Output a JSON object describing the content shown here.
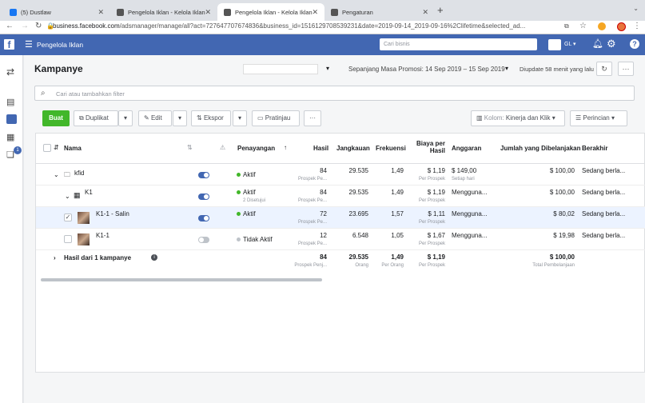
{
  "browser": {
    "tabs": [
      {
        "label": "(5) Dustlaw",
        "active": false
      },
      {
        "label": "Pengelola Iklan - Kelola Iklan",
        "active": false
      },
      {
        "label": "Pengelola Iklan - Kelola Iklan",
        "active": true
      },
      {
        "label": "Pengaturan",
        "active": false
      }
    ],
    "url_host": "business.facebook.com",
    "url_path": "/adsmanager/manage/all?act=727647707674836&business_id=1516129708539231&date=2019-09-14_2019-09-16%2Clifetime&selected_ad..."
  },
  "fbbar": {
    "title": "Pengelola Iklan",
    "business_search_placeholder": "Cari bisnis",
    "account_initials": "GL"
  },
  "leftnav": {
    "badge": "1"
  },
  "page": {
    "title": "Kampanye",
    "daterange": "Sepanjang Masa Promosi: 14 Sep 2019 – 15 Sep 2019",
    "updated": "Diupdate 58 menit yang lalu",
    "filter_placeholder": "Cari atau tambahkan filter"
  },
  "toolbar": {
    "create": "Buat",
    "duplicate": "Duplikat",
    "edit": "Edit",
    "export": "Ekspor",
    "preview": "Pratinjau",
    "more": "···",
    "columns_prefix": "Kolom:",
    "columns_value": "Kinerja dan Klik",
    "breakdown": "Perincian"
  },
  "table": {
    "headers": {
      "name": "Nama",
      "delivery": "Penayangan",
      "results": "Hasil",
      "reach": "Jangkauan",
      "frequency": "Frekuensi",
      "cpr": "Biaya per Hasil",
      "budget": "Anggaran",
      "spent": "Jumlah yang Dibelanjakan",
      "ends": "Berakhir"
    },
    "rows": [
      {
        "name": "kfid",
        "level": "campaign",
        "toggle": true,
        "status": "Aktif",
        "status_sub": "",
        "results": "84",
        "results_sub": "Prospek Pe...",
        "reach": "29.535",
        "freq": "1,49",
        "cpr": "$ 1,19",
        "cpr_sub": "Per Prospek",
        "budget": "$ 149,00",
        "budget_sub": "Setiap hari",
        "spent": "$ 100,00",
        "ends": "Sedang berla..."
      },
      {
        "name": "K1",
        "level": "adset",
        "toggle": true,
        "status": "Aktif",
        "status_sub": "2 Disetujui",
        "results": "84",
        "results_sub": "Prospek Pe...",
        "reach": "29.535",
        "freq": "1,49",
        "cpr": "$ 1,19",
        "cpr_sub": "Per Prospek",
        "budget": "Mengguna...",
        "budget_sub": "",
        "spent": "$ 100,00",
        "ends": "Sedang berla..."
      },
      {
        "name": "K1-1 - Salin",
        "level": "ad",
        "toggle": true,
        "status": "Aktif",
        "status_sub": "",
        "results": "72",
        "results_sub": "Prospek Pe...",
        "reach": "23.695",
        "freq": "1,57",
        "cpr": "$ 1,11",
        "cpr_sub": "Per Prospek",
        "budget": "Mengguna...",
        "budget_sub": "",
        "spent": "$ 80,02",
        "ends": "Sedang berla..."
      },
      {
        "name": "K1-1",
        "level": "ad",
        "toggle": false,
        "status": "Tidak Aktif",
        "status_sub": "",
        "results": "12",
        "results_sub": "Prospek Pe...",
        "reach": "6.548",
        "freq": "1,05",
        "cpr": "$ 1,67",
        "cpr_sub": "Per Prospek",
        "budget": "Mengguna...",
        "budget_sub": "",
        "spent": "$ 19,98",
        "ends": "Sedang berla..."
      }
    ],
    "totals": {
      "label": "Hasil dari 1 kampanye",
      "results": "84",
      "results_sub": "Prospek Penj...",
      "reach": "29.535",
      "reach_sub": "Orang",
      "freq": "1,49",
      "freq_sub": "Per Orang",
      "cpr": "$ 1,19",
      "cpr_sub": "Per Prospek",
      "spent": "$ 100,00",
      "spent_sub": "Total Pembelanjaan"
    }
  },
  "colors": {
    "fb_blue": "#4267b2",
    "green": "#42b72a",
    "active_dot": "#42b72a",
    "inactive_dot": "#bec3c9",
    "selected_row": "#ecf3ff"
  }
}
